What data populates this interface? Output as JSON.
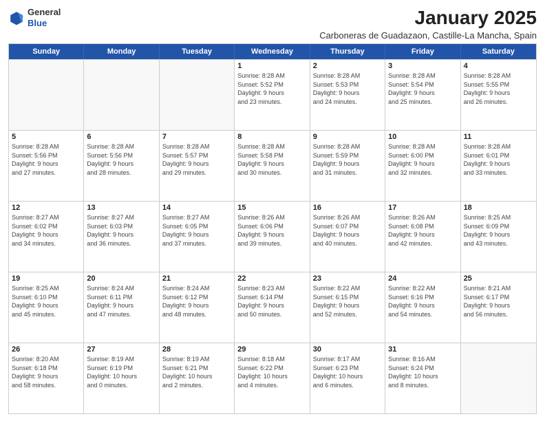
{
  "logo": {
    "general": "General",
    "blue": "Blue"
  },
  "title": "January 2025",
  "subtitle": "Carboneras de Guadazaon, Castille-La Mancha, Spain",
  "headers": [
    "Sunday",
    "Monday",
    "Tuesday",
    "Wednesday",
    "Thursday",
    "Friday",
    "Saturday"
  ],
  "weeks": [
    [
      {
        "day": "",
        "info": ""
      },
      {
        "day": "",
        "info": ""
      },
      {
        "day": "",
        "info": ""
      },
      {
        "day": "1",
        "info": "Sunrise: 8:28 AM\nSunset: 5:52 PM\nDaylight: 9 hours\nand 23 minutes."
      },
      {
        "day": "2",
        "info": "Sunrise: 8:28 AM\nSunset: 5:53 PM\nDaylight: 9 hours\nand 24 minutes."
      },
      {
        "day": "3",
        "info": "Sunrise: 8:28 AM\nSunset: 5:54 PM\nDaylight: 9 hours\nand 25 minutes."
      },
      {
        "day": "4",
        "info": "Sunrise: 8:28 AM\nSunset: 5:55 PM\nDaylight: 9 hours\nand 26 minutes."
      }
    ],
    [
      {
        "day": "5",
        "info": "Sunrise: 8:28 AM\nSunset: 5:56 PM\nDaylight: 9 hours\nand 27 minutes."
      },
      {
        "day": "6",
        "info": "Sunrise: 8:28 AM\nSunset: 5:56 PM\nDaylight: 9 hours\nand 28 minutes."
      },
      {
        "day": "7",
        "info": "Sunrise: 8:28 AM\nSunset: 5:57 PM\nDaylight: 9 hours\nand 29 minutes."
      },
      {
        "day": "8",
        "info": "Sunrise: 8:28 AM\nSunset: 5:58 PM\nDaylight: 9 hours\nand 30 minutes."
      },
      {
        "day": "9",
        "info": "Sunrise: 8:28 AM\nSunset: 5:59 PM\nDaylight: 9 hours\nand 31 minutes."
      },
      {
        "day": "10",
        "info": "Sunrise: 8:28 AM\nSunset: 6:00 PM\nDaylight: 9 hours\nand 32 minutes."
      },
      {
        "day": "11",
        "info": "Sunrise: 8:28 AM\nSunset: 6:01 PM\nDaylight: 9 hours\nand 33 minutes."
      }
    ],
    [
      {
        "day": "12",
        "info": "Sunrise: 8:27 AM\nSunset: 6:02 PM\nDaylight: 9 hours\nand 34 minutes."
      },
      {
        "day": "13",
        "info": "Sunrise: 8:27 AM\nSunset: 6:03 PM\nDaylight: 9 hours\nand 36 minutes."
      },
      {
        "day": "14",
        "info": "Sunrise: 8:27 AM\nSunset: 6:05 PM\nDaylight: 9 hours\nand 37 minutes."
      },
      {
        "day": "15",
        "info": "Sunrise: 8:26 AM\nSunset: 6:06 PM\nDaylight: 9 hours\nand 39 minutes."
      },
      {
        "day": "16",
        "info": "Sunrise: 8:26 AM\nSunset: 6:07 PM\nDaylight: 9 hours\nand 40 minutes."
      },
      {
        "day": "17",
        "info": "Sunrise: 8:26 AM\nSunset: 6:08 PM\nDaylight: 9 hours\nand 42 minutes."
      },
      {
        "day": "18",
        "info": "Sunrise: 8:25 AM\nSunset: 6:09 PM\nDaylight: 9 hours\nand 43 minutes."
      }
    ],
    [
      {
        "day": "19",
        "info": "Sunrise: 8:25 AM\nSunset: 6:10 PM\nDaylight: 9 hours\nand 45 minutes."
      },
      {
        "day": "20",
        "info": "Sunrise: 8:24 AM\nSunset: 6:11 PM\nDaylight: 9 hours\nand 47 minutes."
      },
      {
        "day": "21",
        "info": "Sunrise: 8:24 AM\nSunset: 6:12 PM\nDaylight: 9 hours\nand 48 minutes."
      },
      {
        "day": "22",
        "info": "Sunrise: 8:23 AM\nSunset: 6:14 PM\nDaylight: 9 hours\nand 50 minutes."
      },
      {
        "day": "23",
        "info": "Sunrise: 8:22 AM\nSunset: 6:15 PM\nDaylight: 9 hours\nand 52 minutes."
      },
      {
        "day": "24",
        "info": "Sunrise: 8:22 AM\nSunset: 6:16 PM\nDaylight: 9 hours\nand 54 minutes."
      },
      {
        "day": "25",
        "info": "Sunrise: 8:21 AM\nSunset: 6:17 PM\nDaylight: 9 hours\nand 56 minutes."
      }
    ],
    [
      {
        "day": "26",
        "info": "Sunrise: 8:20 AM\nSunset: 6:18 PM\nDaylight: 9 hours\nand 58 minutes."
      },
      {
        "day": "27",
        "info": "Sunrise: 8:19 AM\nSunset: 6:19 PM\nDaylight: 10 hours\nand 0 minutes."
      },
      {
        "day": "28",
        "info": "Sunrise: 8:19 AM\nSunset: 6:21 PM\nDaylight: 10 hours\nand 2 minutes."
      },
      {
        "day": "29",
        "info": "Sunrise: 8:18 AM\nSunset: 6:22 PM\nDaylight: 10 hours\nand 4 minutes."
      },
      {
        "day": "30",
        "info": "Sunrise: 8:17 AM\nSunset: 6:23 PM\nDaylight: 10 hours\nand 6 minutes."
      },
      {
        "day": "31",
        "info": "Sunrise: 8:16 AM\nSunset: 6:24 PM\nDaylight: 10 hours\nand 8 minutes."
      },
      {
        "day": "",
        "info": ""
      }
    ]
  ]
}
